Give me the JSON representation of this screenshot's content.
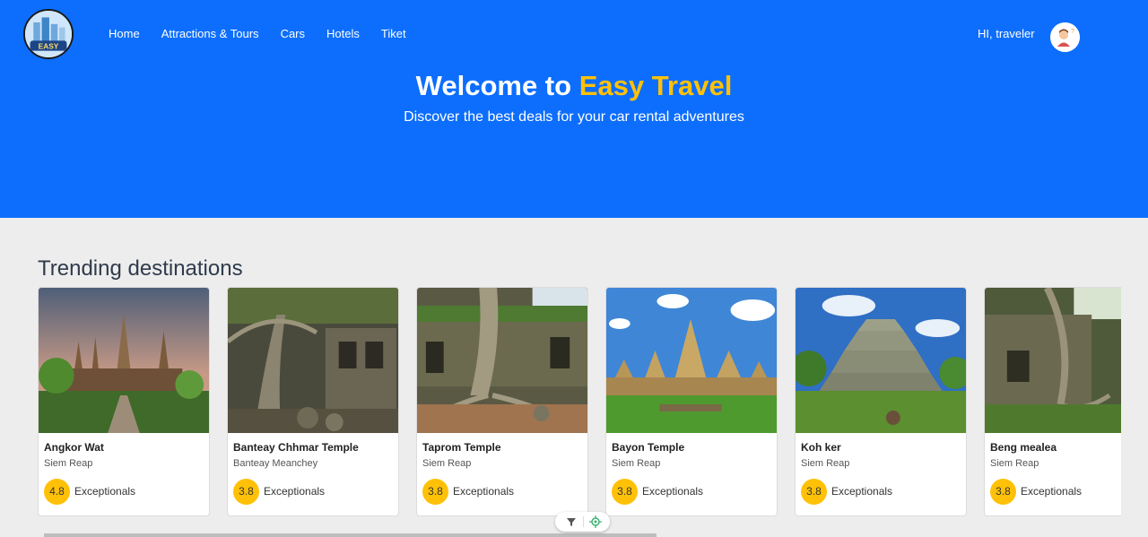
{
  "header": {
    "nav": [
      "Home",
      "Attractions & Tours",
      "Cars",
      "Hotels",
      "Tiket"
    ],
    "greeting": "HI, traveler",
    "logo_icon": "easy-travel-logo",
    "avatar_icon": "traveler-avatar"
  },
  "hero": {
    "title_prefix": "Welcome to",
    "title_accent": "Easy Travel",
    "subtitle": "Discover the best deals for your car rental adventures"
  },
  "trending": {
    "title": "Trending destinations",
    "cards": [
      {
        "name": "Angkor Wat",
        "location": "Siem Reap",
        "score": "4.8",
        "rating": "Exceptionals"
      },
      {
        "name": "Banteay Chhmar Temple",
        "location": "Banteay Meanchey",
        "score": "3.8",
        "rating": "Exceptionals"
      },
      {
        "name": "Taprom Temple",
        "location": "Siem Reap",
        "score": "3.8",
        "rating": "Exceptionals"
      },
      {
        "name": "Bayon Temple",
        "location": "Siem Reap",
        "score": "3.8",
        "rating": "Exceptionals"
      },
      {
        "name": "Koh ker",
        "location": "Siem Reap",
        "score": "3.8",
        "rating": "Exceptionals"
      },
      {
        "name": "Beng mealea",
        "location": "Siem Reap",
        "score": "3.8",
        "rating": "Exceptionals"
      }
    ]
  },
  "colors": {
    "hero_bg": "#0d6efd",
    "accent": "#ffc107",
    "page_bg": "#ededed"
  }
}
